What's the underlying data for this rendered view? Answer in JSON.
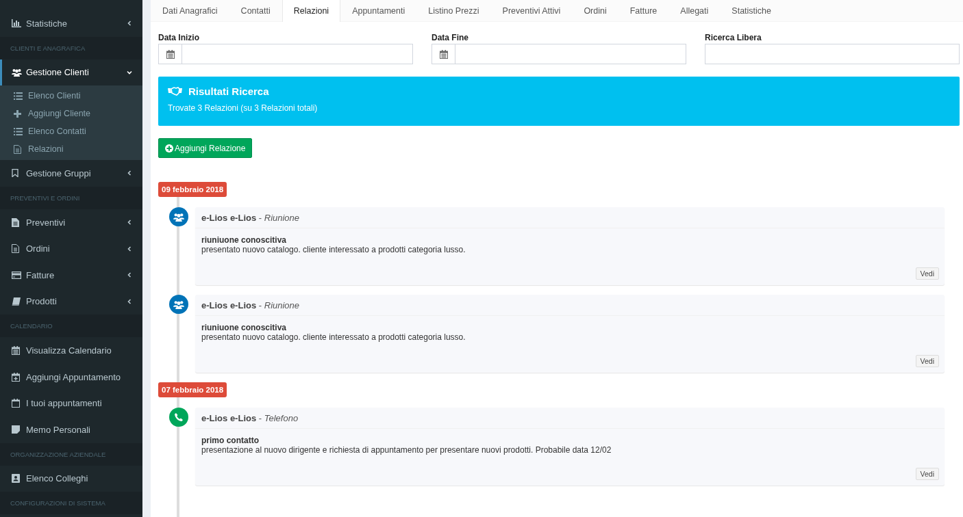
{
  "sidebar": {
    "items": [
      {
        "kind": "link",
        "label": "Statistiche",
        "selected": false,
        "expanded": false
      },
      {
        "kind": "section",
        "label": "CLIENTI E ANAGRAFICA"
      },
      {
        "kind": "link",
        "label": "Gestione Clienti",
        "selected": true,
        "expanded": true,
        "children": [
          {
            "label": "Elenco Clienti",
            "selected": false
          },
          {
            "label": "Aggiungi Cliente",
            "selected": false
          },
          {
            "label": "Elenco Contatti",
            "selected": false
          },
          {
            "label": "Relazioni",
            "selected": false
          }
        ]
      },
      {
        "kind": "link",
        "label": "Gestione Gruppi",
        "selected": false,
        "expanded": false
      },
      {
        "kind": "section",
        "label": "PREVENTIVI E ORDINI"
      },
      {
        "kind": "link",
        "label": "Preventivi",
        "selected": false,
        "expanded": false
      },
      {
        "kind": "link",
        "label": "Ordini",
        "selected": false,
        "expanded": false
      },
      {
        "kind": "link",
        "label": "Fatture",
        "selected": false,
        "expanded": false
      },
      {
        "kind": "link",
        "label": "Prodotti",
        "selected": false,
        "expanded": false
      },
      {
        "kind": "section",
        "label": "CALENDARIO"
      },
      {
        "kind": "link",
        "label": "Visualizza Calendario",
        "selected": false
      },
      {
        "kind": "link",
        "label": "Aggiungi Appuntamento",
        "selected": false
      },
      {
        "kind": "link",
        "label": "I tuoi appuntamenti",
        "selected": false
      },
      {
        "kind": "link",
        "label": "Memo Personali",
        "selected": false
      },
      {
        "kind": "section",
        "label": "ORGANIZZAZIONE AZIENDALE"
      },
      {
        "kind": "link",
        "label": "Elenco Colleghi",
        "selected": false
      },
      {
        "kind": "section",
        "label": "CONFIGURAZIONI DI SISTEMA"
      }
    ]
  },
  "tabs": [
    {
      "label": "Dati Anagrafici",
      "selected": false
    },
    {
      "label": "Contatti",
      "selected": false
    },
    {
      "label": "Relazioni",
      "selected": true
    },
    {
      "label": "Appuntamenti",
      "selected": false
    },
    {
      "label": "Listino Prezzi",
      "selected": false
    },
    {
      "label": "Preventivi Attivi",
      "selected": false
    },
    {
      "label": "Ordini",
      "selected": false
    },
    {
      "label": "Fatture",
      "selected": false
    },
    {
      "label": "Allegati",
      "selected": false
    },
    {
      "label": "Statistiche",
      "selected": false
    }
  ],
  "filters": [
    {
      "kind": "date",
      "label": "Data Inizio"
    },
    {
      "kind": "date",
      "label": "Data Fine"
    },
    {
      "kind": "text",
      "label": "Ricerca Libera"
    }
  ],
  "results": {
    "title": "Risultati Ricerca",
    "text": "Trovate 3 Relazioni (su 3 Relazioni totali)"
  },
  "add_button": "Aggiungi Relazione",
  "timeline": [
    {
      "kind": "date",
      "label": "09 febbraio 2018"
    },
    {
      "kind": "meeting",
      "color": "#0073b7",
      "header": "**e-Lios e-Lios** - *Riunione*",
      "title": "riuniuone conoscitiva",
      "text": "presentato nuovo catalogo. cliente interessato a prodotti categoria lusso.",
      "button": "Vedi"
    },
    {
      "kind": "meeting",
      "color": "#0073b7",
      "header": "**e-Lios e-Lios** - *Riunione*",
      "title": "riuniuone conoscitiva",
      "text": "presentato nuovo catalogo. cliente interessato a prodotti categoria lusso.",
      "button": "Vedi"
    },
    {
      "kind": "date",
      "label": "07 febbraio 2018"
    },
    {
      "kind": "call",
      "color": "#00a65a",
      "header": "**e-Lios e-Lios** - *Telefono*",
      "title": "primo contatto",
      "text": "presentazione al nuovo dirigente e richiesta di appuntamento per presentare nuovi prodotti. Probabile data 12/02",
      "button": "Vedi"
    }
  ]
}
